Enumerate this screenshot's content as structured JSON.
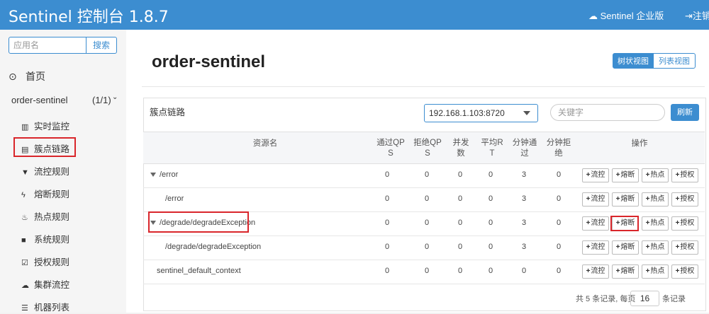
{
  "header": {
    "title": "Sentinel 控制台 1.8.7",
    "enterprise_label": "Sentinel 企业版",
    "logout_label": "注销"
  },
  "sidebar": {
    "search_placeholder": "应用名",
    "search_button": "搜索",
    "home_label": "首页",
    "app": {
      "name": "order-sentinel",
      "count": "(1/1)"
    },
    "menu": [
      {
        "label": "实时监控",
        "icon": "bar-chart-icon"
      },
      {
        "label": "簇点链路",
        "icon": "list-icon"
      },
      {
        "label": "流控规则",
        "icon": "filter-icon"
      },
      {
        "label": "熔断规则",
        "icon": "flash-icon"
      },
      {
        "label": "热点规则",
        "icon": "fire-icon"
      },
      {
        "label": "系统规则",
        "icon": "lock-icon"
      },
      {
        "label": "授权规则",
        "icon": "check-icon"
      },
      {
        "label": "集群流控",
        "icon": "cloud-icon"
      },
      {
        "label": "机器列表",
        "icon": "list-icon"
      }
    ]
  },
  "main": {
    "title": "order-sentinel",
    "view_tree": "树状视图",
    "view_list": "列表视图",
    "panel_title": "簇点链路",
    "machine": "192.168.1.103:8720",
    "keyword_placeholder": "关键字",
    "refresh": "刷新",
    "columns": {
      "resource": "资源名",
      "pass_qps": [
        "通过QP",
        "S"
      ],
      "block_qps": [
        "拒绝QP",
        "S"
      ],
      "concurrency": [
        "并发",
        "数"
      ],
      "avg_rt": [
        "平均R",
        "T"
      ],
      "minute_pass": [
        "分钟通",
        "过"
      ],
      "minute_block": [
        "分钟拒",
        "绝"
      ],
      "ops": "操作"
    },
    "op_labels": [
      "流控",
      "熔断",
      "热点",
      "授权"
    ],
    "rows": [
      {
        "name": "/error",
        "v": [
          "0",
          "0",
          "0",
          "0",
          "3",
          "0"
        ]
      },
      {
        "name": "/error",
        "v": [
          "0",
          "0",
          "0",
          "0",
          "3",
          "0"
        ]
      },
      {
        "name": "/degrade/degradeException",
        "v": [
          "0",
          "0",
          "0",
          "0",
          "3",
          "0"
        ]
      },
      {
        "name": "/degrade/degradeException",
        "v": [
          "0",
          "0",
          "0",
          "0",
          "3",
          "0"
        ]
      },
      {
        "name": "sentinel_default_context",
        "v": [
          "0",
          "0",
          "0",
          "0",
          "0",
          "0"
        ]
      }
    ],
    "pager": {
      "prefix": "共 5 条记录, 每页",
      "size": "16",
      "suffix": "条记录"
    }
  },
  "colors": {
    "accent": "#3c8dd0",
    "highlight": "#d9262b"
  }
}
